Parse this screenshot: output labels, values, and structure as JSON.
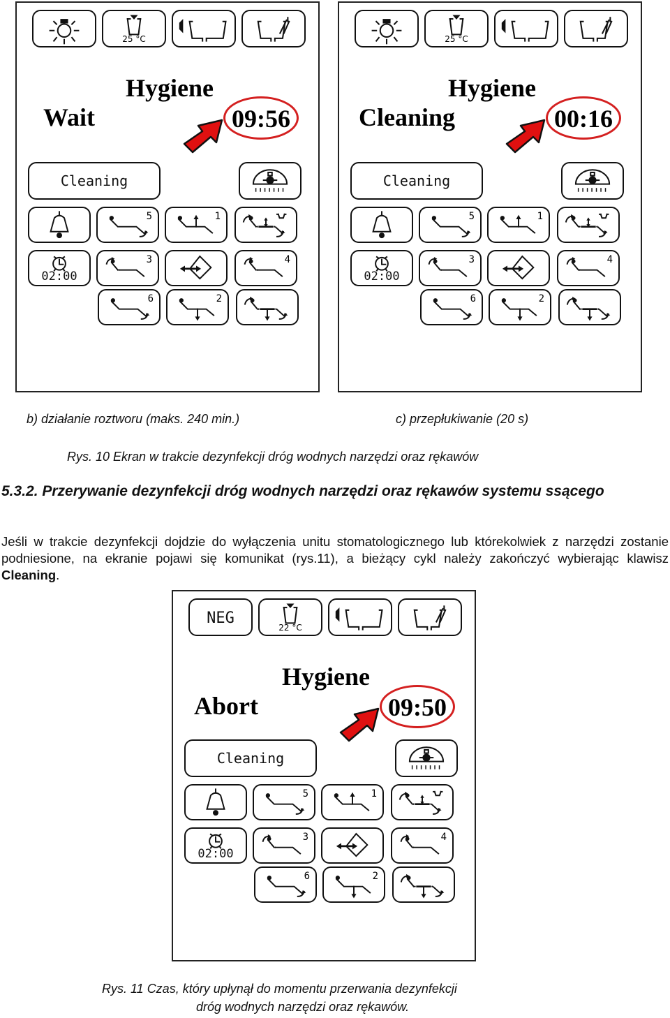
{
  "figure10": {
    "panels": [
      {
        "id": "b",
        "top_buttons": [
          {
            "icon": "operating-light-icon"
          },
          {
            "icon": "cup-filler-icon",
            "temp": "25 °C"
          },
          {
            "icon": "basin-rinse-icon"
          },
          {
            "icon": "basin-flush-icon"
          }
        ],
        "title": "Hygiene",
        "status": "Wait",
        "timer": "09:56",
        "cleaning_label": "Cleaning",
        "timer_button_label": "02:00",
        "program_numbers": [
          "5",
          "1",
          "3",
          "4",
          "6",
          "2"
        ]
      },
      {
        "id": "c",
        "top_buttons": [
          {
            "icon": "operating-light-icon"
          },
          {
            "icon": "cup-filler-icon",
            "temp": "25 °C"
          },
          {
            "icon": "basin-rinse-icon"
          },
          {
            "icon": "basin-flush-icon"
          }
        ],
        "title": "Hygiene",
        "status": "Cleaning",
        "timer": "00:16",
        "cleaning_label": "Cleaning",
        "timer_button_label": "02:00",
        "program_numbers": [
          "5",
          "1",
          "3",
          "4",
          "6",
          "2"
        ]
      }
    ],
    "subcaption_b": "b) działanie roztworu (maks. 240 min.)",
    "subcaption_c": "c) przepłukiwanie (20 s)",
    "caption": "Rys. 10  Ekran w trakcie dezynfekcji dróg wodnych narzędzi oraz rękawów"
  },
  "section": {
    "heading": "5.3.2. Przerywanie dezynfekcji dróg wodnych narzędzi oraz rękawów systemu ssącego",
    "paragraph_before": "Jeśli w trakcie dezynfekcji dojdzie do wyłączenia unitu stomatologicznego lub którekolwiek z narzędzi zostanie podniesione, na ekranie pojawi się komunikat (rys.11), a bieżący cykl należy zakończyć wybierając klawisz ",
    "paragraph_bold": "Cleaning",
    "paragraph_after": "."
  },
  "figure11": {
    "top_buttons": [
      {
        "label": "NEG"
      },
      {
        "icon": "cup-filler-icon",
        "temp": "22 °C"
      },
      {
        "icon": "basin-rinse-icon"
      },
      {
        "icon": "basin-flush-icon"
      }
    ],
    "title": "Hygiene",
    "status": "Abort",
    "timer": "09:50",
    "cleaning_label": "Cleaning",
    "timer_button_label": "02:00",
    "program_numbers": [
      "5",
      "1",
      "3",
      "4",
      "6",
      "2"
    ],
    "caption_line1": "Rys. 11  Czas, który upłynął do momentu przerwania dezynfekcji",
    "caption_line2": "dróg wodnych narzędzi oraz rękawów."
  },
  "colors": {
    "highlight": "#d42020",
    "arrow_fill": "#e01010"
  }
}
